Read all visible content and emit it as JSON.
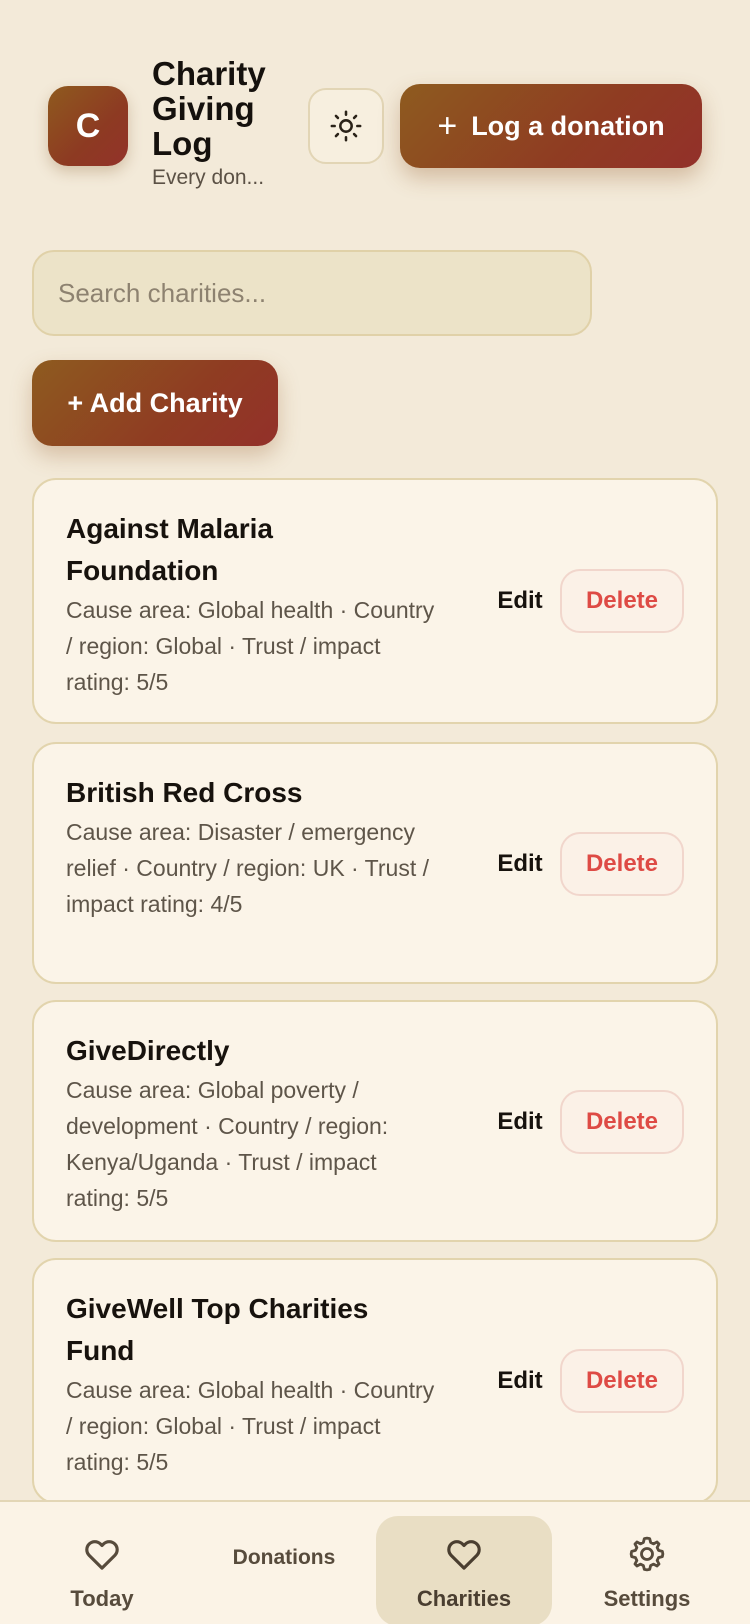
{
  "header": {
    "logo_letter": "C",
    "title": "Charity Giving Log",
    "subtitle": "Every don...",
    "theme_icon": "sun-icon",
    "log_donation_label": "Log a donation"
  },
  "search": {
    "placeholder": "Search charities...",
    "value": ""
  },
  "add_charity_label": "+ Add Charity",
  "charities": [
    {
      "name": "Against Malaria Foundation",
      "meta": "Cause area: Global health · Country / region: Global · Trust / impact rating: 5/5",
      "edit_label": "Edit",
      "delete_label": "Delete"
    },
    {
      "name": "British Red Cross",
      "meta": "Cause area: Disaster / emergency relief · Country / region: UK · Trust / impact rating: 4/5",
      "edit_label": "Edit",
      "delete_label": "Delete"
    },
    {
      "name": "GiveDirectly",
      "meta": "Cause area: Global poverty / development · Country / region: Kenya/Uganda · Trust / impact rating: 5/5",
      "edit_label": "Edit",
      "delete_label": "Delete"
    },
    {
      "name": "GiveWell Top Charities Fund",
      "meta": "Cause area: Global health · Country / region: Global · Trust / impact rating: 5/5",
      "edit_label": "Edit",
      "delete_label": "Delete"
    }
  ],
  "nav": {
    "today": "Today",
    "donations": "Donations",
    "charities": "Charities",
    "settings": "Settings",
    "active": "Charities"
  },
  "colors": {
    "background": "#f3ead9",
    "accent_start": "#8e5b1f",
    "accent_end": "#93302a",
    "delete": "#de4b45"
  }
}
